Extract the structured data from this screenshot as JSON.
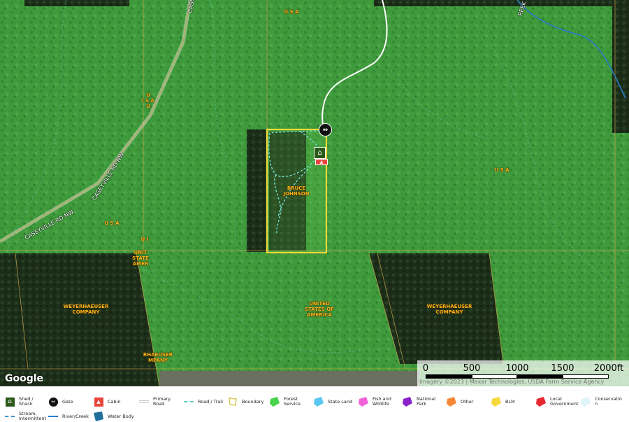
{
  "map": {
    "parcels": [
      {
        "id": "usa-1",
        "label": "U S A"
      },
      {
        "id": "usa-2",
        "label": "U\nI S A\nU"
      },
      {
        "id": "usa-3",
        "label": "U S A"
      },
      {
        "id": "usa-4",
        "label": "U S A"
      },
      {
        "id": "ui-1",
        "label": "U I"
      },
      {
        "id": "unit-state",
        "label": "UNIT\nSTATE\nAMER"
      },
      {
        "id": "johnson",
        "label": "BRUCE\nJOHNSON"
      },
      {
        "id": "usoa",
        "label": "UNITED\nSTATES OF\nAMERICA"
      },
      {
        "id": "weyer-1",
        "label": "WEYERHAEUSER\nCOMPANY"
      },
      {
        "id": "weyer-2",
        "label": "WEYERHAEUSER\nCOMPANY"
      },
      {
        "id": "weyer-3",
        "label": "RHAEUSER\nMPANY"
      }
    ],
    "roads": [
      {
        "id": "caseyville-1",
        "label": "CASEYVILLE RD NW"
      },
      {
        "id": "caseyville-2",
        "label": "CASEYVILLE RD NW"
      },
      {
        "id": "casey-top",
        "label": "CASE"
      },
      {
        "id": "creek",
        "label": "REEK"
      }
    ],
    "markers": {
      "gate_icon": "gate-icon",
      "shed_icon": "shed-icon",
      "cabin_icon": "cabin-icon"
    },
    "google_logo": "Google",
    "scale": {
      "ticks": [
        "0",
        "500",
        "1000",
        "1500",
        "2000ft"
      ]
    },
    "attribution": "Imagery ©2023 | Maxar Technologies, USDA Farm Service Agency"
  },
  "legend": {
    "items": [
      {
        "id": "shed",
        "label": "Shed /\nShack",
        "color": "#2a5a1a"
      },
      {
        "id": "gate",
        "label": "Gate",
        "color": "#111111"
      },
      {
        "id": "cabin",
        "label": "Cabin",
        "color": "#e8453c"
      },
      {
        "id": "primary-road",
        "label": "Primary\nRoad",
        "color": "#ffffff"
      },
      {
        "id": "road-trail",
        "label": "Road / Trail",
        "color": "#5fd0c8"
      },
      {
        "id": "boundary",
        "label": "Boundary",
        "color": "#d8c85a"
      },
      {
        "id": "forest-service",
        "label": "Forest\nService",
        "color": "#47d44a"
      },
      {
        "id": "state-land",
        "label": "State Land",
        "color": "#5cc8ef"
      },
      {
        "id": "fish-wildlife",
        "label": "Fish and\nWildlife",
        "color": "#f062d8"
      },
      {
        "id": "national-park",
        "label": "National\nPark",
        "color": "#8a22c9"
      },
      {
        "id": "other",
        "label": "Other",
        "color": "#f5873a"
      },
      {
        "id": "blm",
        "label": "BLM",
        "color": "#f5d93a"
      },
      {
        "id": "local-government",
        "label": "Local\nGovernment",
        "color": "#e8262e"
      },
      {
        "id": "conservation",
        "label": "Conservatio\nn",
        "color": "#e0f4fa"
      },
      {
        "id": "stream",
        "label": "Stream,\nIntermittent",
        "color": "#3a9ad8"
      },
      {
        "id": "river-creek",
        "label": "River/Creek",
        "color": "#2a7ac8"
      },
      {
        "id": "water-body",
        "label": "Water Body",
        "color": "#1e6f9a"
      }
    ]
  }
}
